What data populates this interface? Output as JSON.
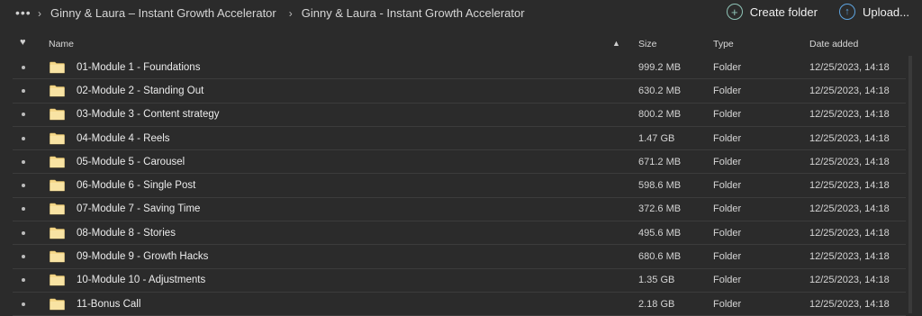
{
  "breadcrumb": {
    "more": "•••",
    "items": [
      "Ginny & Laura – Instant Growth Accelerator",
      "Ginny & Laura - Instant Growth Accelerator"
    ]
  },
  "actions": {
    "create_folder": "Create folder",
    "upload": "Upload..."
  },
  "table": {
    "headers": {
      "name": "Name",
      "size": "Size",
      "type": "Type",
      "date": "Date added"
    },
    "rows": [
      {
        "name": "01-Module 1 - Foundations",
        "size": "999.2 MB",
        "type": "Folder",
        "date": "12/25/2023, 14:18"
      },
      {
        "name": "02-Module 2 - Standing Out",
        "size": "630.2 MB",
        "type": "Folder",
        "date": "12/25/2023, 14:18"
      },
      {
        "name": "03-Module 3 - Content strategy",
        "size": "800.2 MB",
        "type": "Folder",
        "date": "12/25/2023, 14:18"
      },
      {
        "name": "04-Module 4 - Reels",
        "size": "1.47 GB",
        "type": "Folder",
        "date": "12/25/2023, 14:18"
      },
      {
        "name": "05-Module 5 - Carousel",
        "size": "671.2 MB",
        "type": "Folder",
        "date": "12/25/2023, 14:18"
      },
      {
        "name": "06-Module 6 - Single Post",
        "size": "598.6 MB",
        "type": "Folder",
        "date": "12/25/2023, 14:18"
      },
      {
        "name": "07-Module 7 - Saving Time",
        "size": "372.6 MB",
        "type": "Folder",
        "date": "12/25/2023, 14:18"
      },
      {
        "name": "08-Module 8 - Stories",
        "size": "495.6 MB",
        "type": "Folder",
        "date": "12/25/2023, 14:18"
      },
      {
        "name": "09-Module 9 - Growth Hacks",
        "size": "680.6 MB",
        "type": "Folder",
        "date": "12/25/2023, 14:18"
      },
      {
        "name": "10-Module 10 - Adjustments",
        "size": "1.35 GB",
        "type": "Folder",
        "date": "12/25/2023, 14:18"
      },
      {
        "name": "11-Bonus Call",
        "size": "2.18 GB",
        "type": "Folder",
        "date": "12/25/2023, 14:18"
      }
    ]
  },
  "colors": {
    "background": "#2b2b2b",
    "folder": "#f5d88a",
    "create_accent": "#8fc4b7",
    "upload_accent": "#5ea4e0"
  },
  "icons": {
    "heart": "heart-icon",
    "folder": "folder-icon",
    "plus": "plus-circle-icon",
    "upload": "upload-icon"
  }
}
